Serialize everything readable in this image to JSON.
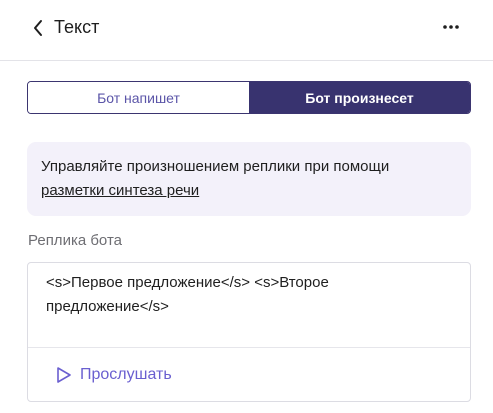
{
  "header": {
    "title": "Текст",
    "back_icon": "chevron-left-icon",
    "more_icon": "more-horizontal-icon"
  },
  "mode_toggle": {
    "options": [
      "Бот напишет",
      "Бот произнесет"
    ],
    "selected": "Бот произнесет"
  },
  "info": {
    "text": "Управляйте произношением реплики при помощи",
    "link": "разметки синтеза речи"
  },
  "reply": {
    "label": "Реплика бота",
    "value": "<s>Первое предложение</s> <s>Второе предложение</s>",
    "listen_label": "Прослушать",
    "listen_icon": "play-icon"
  },
  "colors": {
    "accent": "#38336f",
    "link_accent": "#6a5fd0",
    "info_bg": "#f3f1fa"
  }
}
